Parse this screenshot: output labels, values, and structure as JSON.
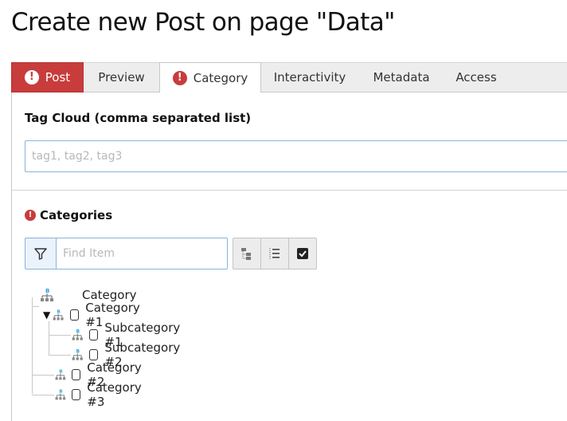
{
  "page": {
    "title": "Create new Post on page \"Data\""
  },
  "tabs": [
    {
      "label": "Post",
      "error": true
    },
    {
      "label": "Preview"
    },
    {
      "label": "Category",
      "error": true,
      "active": true
    },
    {
      "label": "Interactivity"
    },
    {
      "label": "Metadata"
    },
    {
      "label": "Access"
    }
  ],
  "tag_cloud": {
    "label": "Tag Cloud (comma separated list)",
    "placeholder": "tag1, tag2, tag3",
    "value": ""
  },
  "categories": {
    "label": "Categories",
    "search_placeholder": "Find Item",
    "tree": {
      "root": "Category",
      "items": [
        {
          "label": "Category #1",
          "expanded": true,
          "checked": false,
          "children": [
            {
              "label": "Subcategory #1",
              "checked": false
            },
            {
              "label": "Subcategory #2",
              "checked": false
            }
          ]
        },
        {
          "label": "Category #2",
          "checked": false
        },
        {
          "label": "Category #3",
          "checked": false
        }
      ]
    }
  },
  "colors": {
    "error": "#c83c3c",
    "input_border": "#8ab4d8",
    "tab_bg": "#ededed",
    "node_icon": "#2a9fd6"
  }
}
